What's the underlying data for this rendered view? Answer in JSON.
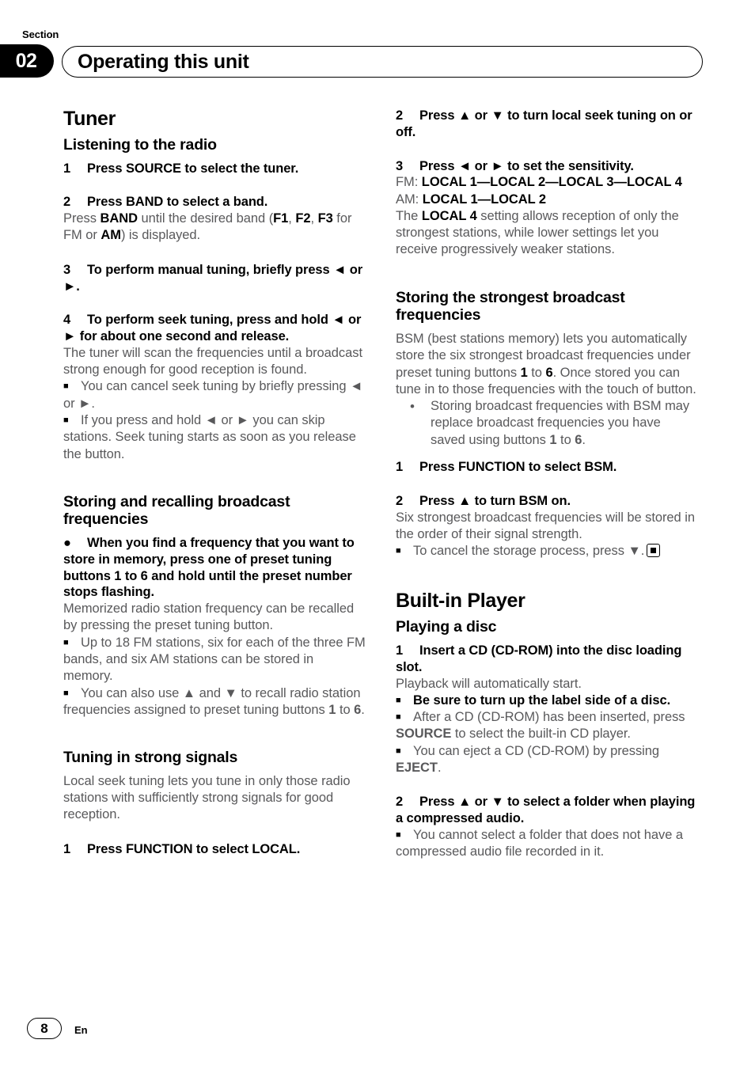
{
  "header": {
    "section_label": "Section",
    "section_number": "02",
    "title": "Operating this unit"
  },
  "footer": {
    "page_number": "8",
    "language": "En"
  },
  "left_column": {
    "h1_tuner": "Tuner",
    "h2_listening": "Listening to the radio",
    "step1_num": "1",
    "step1_text": "Press SOURCE to select the tuner.",
    "step2_num": "2",
    "step2_text": "Press BAND to select a band.",
    "step2_body_a": "Press ",
    "step2_body_b": "BAND",
    "step2_body_c": " until the desired band (",
    "step2_body_f1": "F1",
    "step2_body_sep1": ", ",
    "step2_body_f2": "F2",
    "step2_body_sep2": ", ",
    "step2_body_f3": "F3",
    "step2_body_d": " for FM or ",
    "step2_body_am": "AM",
    "step2_body_e": ") is displayed.",
    "step3_num": "3",
    "step3_text": "To perform manual tuning, briefly press ◄ or ►.",
    "step4_num": "4",
    "step4_text": "To perform seek tuning, press and hold ◄ or ► for about one second and release.",
    "step4_body": "The tuner will scan the frequencies until a broadcast strong enough for good reception is found.",
    "note4_1": "You can cancel seek tuning by briefly pressing ◄ or ►.",
    "note4_2": "If you press and hold ◄ or ► you can skip stations. Seek tuning starts as soon as you release the button.",
    "h2_storing": "Storing and recalling broadcast frequencies",
    "bullet_storing": "When you find a frequency that you want to store in memory, press one of preset tuning buttons 1 to 6 and hold until the preset number stops flashing.",
    "storing_body": "Memorized radio station frequency can be recalled by pressing the preset tuning button.",
    "note_storing_1": "Up to 18 FM stations, six for each of the three FM bands, and six AM stations can be stored in memory.",
    "note_storing_2a": "You can also use ▲ and ▼ to recall radio station frequencies assigned to preset tuning buttons ",
    "note_storing_2b": "1",
    "note_storing_2c": " to ",
    "note_storing_2d": "6",
    "note_storing_2e": ".",
    "h2_tuning": "Tuning in strong signals",
    "tuning_body": "Local seek tuning lets you tune in only those radio stations with sufficiently strong signals for good reception.",
    "tuning_step1_num": "1",
    "tuning_step1_text": "Press FUNCTION to select LOCAL."
  },
  "right_column": {
    "step2_num": "2",
    "step2_text": "Press ▲ or ▼ to turn local seek tuning on or off.",
    "step3_num": "3",
    "step3_text": "Press ◄ or ► to set the sensitivity.",
    "fm_prefix": "FM: ",
    "fm_values": "LOCAL 1—LOCAL 2—LOCAL 3—LOCAL 4",
    "am_prefix": "AM: ",
    "am_values": "LOCAL 1—LOCAL 2",
    "local4_a": "The ",
    "local4_b": "LOCAL 4",
    "local4_c": " setting allows reception of only the strongest stations, while lower settings let you receive progressively weaker stations.",
    "h2_strongest": "Storing the strongest broadcast frequencies",
    "bsm_body_a": "BSM (best stations memory) lets you automatically store the six strongest broadcast frequencies under preset tuning buttons ",
    "bsm_body_b": "1",
    "bsm_body_c": " to ",
    "bsm_body_d": "6",
    "bsm_body_e": ". Once stored you can tune in to those frequencies with the touch of button.",
    "dotnote_a": "Storing broadcast frequencies with BSM may replace broadcast frequencies you have saved using buttons ",
    "dotnote_b": "1",
    "dotnote_c": " to ",
    "dotnote_d": "6",
    "dotnote_e": ".",
    "bsm_step1_num": "1",
    "bsm_step1_text": "Press FUNCTION to select BSM.",
    "bsm_step2_num": "2",
    "bsm_step2_text": "Press ▲ to turn BSM on.",
    "bsm_step2_body": "Six strongest broadcast frequencies will be stored in the order of their signal strength.",
    "bsm_note": "To cancel the storage process, press ▼.",
    "h1_player": "Built-in Player",
    "h2_playing": "Playing a disc",
    "disc_step1_num": "1",
    "disc_step1_text": "Insert a CD (CD-ROM) into the disc loading slot.",
    "disc_step1_body": "Playback will automatically start.",
    "disc_note_bold": "Be sure to turn up the label side of a disc.",
    "disc_note_2a": "After a CD (CD-ROM) has been inserted, press ",
    "disc_note_2b": "SOURCE",
    "disc_note_2c": " to select the built-in CD player.",
    "disc_note_3a": "You can eject a CD (CD-ROM) by pressing ",
    "disc_note_3b": "EJECT",
    "disc_note_3c": ".",
    "disc_step2_num": "2",
    "disc_step2_text": "Press ▲ or ▼ to select a folder when playing a compressed audio.",
    "disc_note_4": "You cannot select a folder that does not have a compressed audio file recorded in it."
  }
}
